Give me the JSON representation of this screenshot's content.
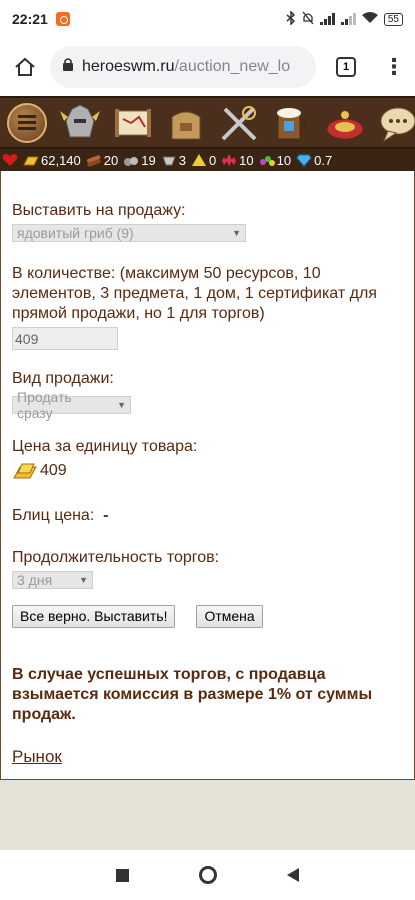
{
  "status_bar": {
    "time": "22:21",
    "battery": "55"
  },
  "browser": {
    "url_host": "heroeswm.ru",
    "url_path": "/auction_new_lo",
    "tab_count": "1"
  },
  "game_nav": {
    "icons": [
      "menu-icon",
      "knight-helmet-icon",
      "map-scroll-icon",
      "inventory-bag-icon",
      "crossed-swords-icon",
      "tavern-mug-icon",
      "roulette-icon",
      "chat-bubble-icon"
    ]
  },
  "resources": {
    "gold": "62,140",
    "wood": "20",
    "ore": "19",
    "mercury": "3",
    "sulfur": "0",
    "crystals": "10",
    "gems": "10",
    "diamonds": "0.7"
  },
  "form": {
    "sell_label": "Выставить на продажу:",
    "sell_item": "ядовитый гриб (9)",
    "quantity_label": "В количестве: (максимум 50 ресурсов, 10 элементов, 3 предмета, 1 дом, 1 сертификат для прямой продажи, но 1 для торгов)",
    "quantity_value": "409",
    "sale_type_label": "Вид продажи:",
    "sale_type_value": "Продать сразу",
    "price_label": "Цена за единицу товара:",
    "price_value": "409",
    "blitz_label": "Блиц цена:",
    "blitz_value": "-",
    "duration_label": "Продолжительность торгов:",
    "duration_value": "3 дня",
    "confirm_button": "Все верно. Выставить!",
    "cancel_button": "Отмена",
    "commission_note": "В случае успешных торгов, с продавца взымается комиссия в размере 1% от суммы продаж.",
    "market_link": "Рынок"
  }
}
